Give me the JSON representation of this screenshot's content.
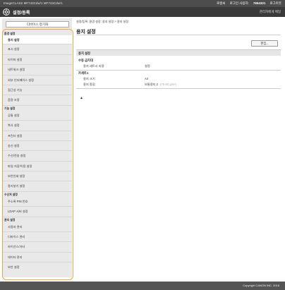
{
  "header": {
    "device_info": "ImageCLASS  MF743Cdw/1   MF743Cdw/1",
    "login_label": "로컬씨",
    "login_user_label": "로그인 사용자:",
    "login_user": "7654321",
    "logout_label": "로그아웃"
  },
  "titlebar": {
    "app_title": "설정/등록",
    "admin_mode": "관리자에게 메일"
  },
  "sidebar": {
    "device_button": "디바이스 정기화",
    "categories": [
      {
        "title": "환경 설정",
        "items": [
          "용지 설정",
          "표시 설정",
          "타이머 설정",
          "네트워크 설정",
          "외부 인터페이스 설정",
          "접근성 기능",
          "음량 조정"
        ]
      },
      {
        "title": "기능 설정",
        "items": [
          "공통 설정",
          "복사 설정",
          "프린터 설정",
          "송신 설정",
          "수신/전송 설정",
          "파일 저장/이용 설정",
          "보안인쇄 설정",
          "용지넣기 설정"
        ]
      },
      {
        "title": "수신처 설정",
        "items": [
          "주소록 PIN 번호",
          "LDAP 서버 설정"
        ]
      },
      {
        "title": "관리 설정",
        "items": [
          "사용자 관리",
          "디바이스 관리",
          "라이선스/기타",
          "데이터 관리",
          "보안 설정"
        ]
      }
    ]
  },
  "main": {
    "breadcrumb": "설정/등록: 환경 설정: 용지 설정 > 용지 설정",
    "page_title": "용지 설정",
    "edit_button": "편집...",
    "section_title": "용지 설정",
    "manual_feed_title": "수동 급지대",
    "manual_feed_label": "용지 세트시 지정:",
    "manual_feed_value": "설정",
    "cassette_title": "카세트1",
    "paper_size_label": "용지 크기:",
    "paper_size_value": "A4",
    "paper_type_label": "용지 종류:",
    "paper_type_value": "보통용지 2",
    "paper_type_extra": "(75-90 g/m²)",
    "top_link": "▲"
  },
  "footer": {
    "copyright": "Copyright CANON INC. 2018"
  },
  "colors": {
    "highlight": "#f0a63a",
    "topbar": "#4d4d4d",
    "titlebar": "#3a3a3a"
  }
}
